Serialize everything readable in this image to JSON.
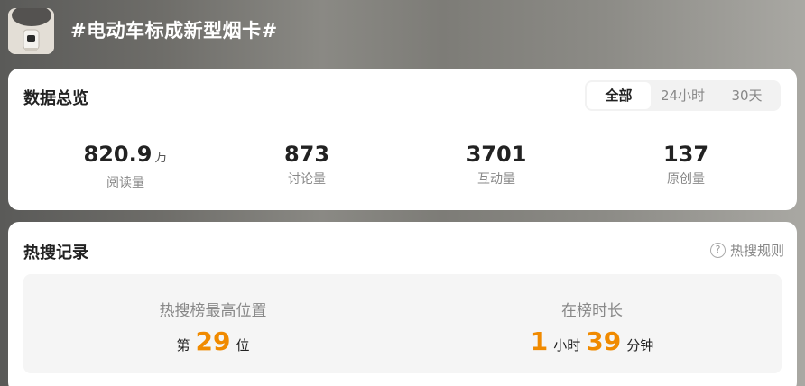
{
  "header": {
    "title": "#电动车标成新型烟卡#"
  },
  "overview": {
    "title": "数据总览",
    "tabs": [
      {
        "label": "全部",
        "active": true
      },
      {
        "label": "24小时",
        "active": false
      },
      {
        "label": "30天",
        "active": false
      }
    ],
    "stats": [
      {
        "value": "820.9",
        "unit": "万",
        "label": "阅读量"
      },
      {
        "value": "873",
        "unit": "",
        "label": "讨论量"
      },
      {
        "value": "3701",
        "unit": "",
        "label": "互动量"
      },
      {
        "value": "137",
        "unit": "",
        "label": "原创量"
      }
    ]
  },
  "hot": {
    "title": "热搜记录",
    "rules_label": "热搜规则",
    "rules_icon": "question-icon",
    "highest": {
      "label": "热搜榜最高位置",
      "prefix": "第",
      "value": "29",
      "suffix": "位"
    },
    "duration": {
      "label": "在榜时长",
      "hours": "1",
      "hours_unit": "小时",
      "minutes": "39",
      "minutes_unit": "分钟"
    }
  },
  "colors": {
    "accent": "#f08a00",
    "card_bg": "#ffffff",
    "muted_text": "#888888"
  }
}
